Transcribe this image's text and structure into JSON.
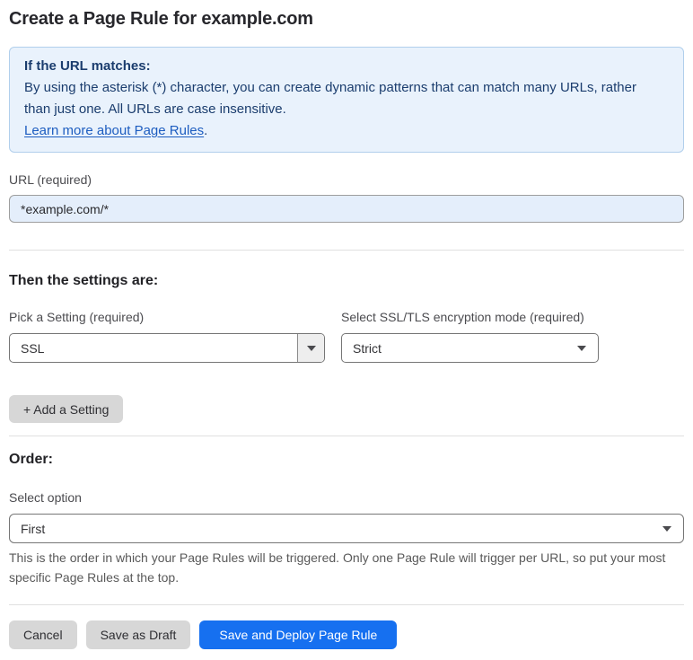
{
  "page": {
    "title": "Create a Page Rule for example.com"
  },
  "info_box": {
    "heading": "If the URL matches:",
    "body": "By using the asterisk (*) character, you can create dynamic patterns that can match many URLs, rather than just one. All URLs are case insensitive.",
    "link_text": "Learn more about Page Rules",
    "link_suffix": "."
  },
  "url_field": {
    "label": "URL (required)",
    "value": "*example.com/*"
  },
  "settings": {
    "heading": "Then the settings are:",
    "pick_label": "Pick a Setting (required)",
    "pick_value": "SSL",
    "mode_label": "Select SSL/TLS encryption mode (required)",
    "mode_value": "Strict",
    "add_button_label": "+ Add a Setting"
  },
  "order": {
    "heading": "Order:",
    "label": "Select option",
    "value": "First",
    "help": "This is the order in which your Page Rules will be triggered. Only one Page Rule will trigger per URL, so put your most specific Page Rules at the top."
  },
  "footer": {
    "cancel_label": "Cancel",
    "save_draft_label": "Save as Draft",
    "save_deploy_label": "Save and Deploy Page Rule"
  },
  "colors": {
    "primary_button": "#1670f0",
    "info_box_bg": "#e9f2fc",
    "info_box_border": "#b1cfec",
    "info_text": "#1b3d6e",
    "link": "#1d5dc0",
    "url_input_bg": "#e4eefb",
    "gray_button_bg": "#d7d7d7",
    "divider": "#e0e0e0"
  }
}
